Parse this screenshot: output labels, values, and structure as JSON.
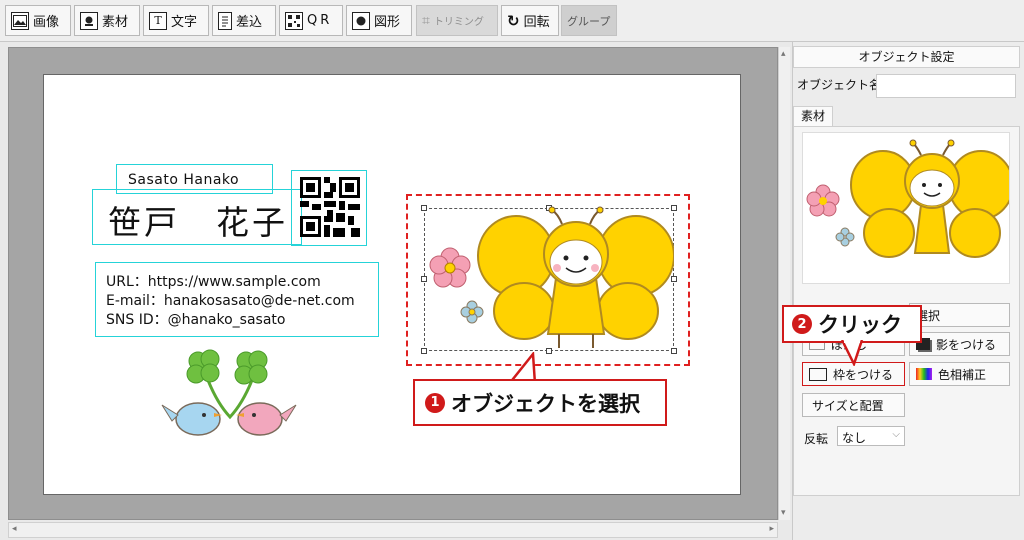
{
  "toolbar": {
    "image": "画像",
    "material": "素材",
    "text": "文字",
    "merge": "差込",
    "qr": "QR",
    "shape": "図形",
    "trimming": "トリミング",
    "rotate": "回転",
    "group": "グループ",
    "text_icon": "T"
  },
  "card": {
    "name_en": "Sasato Hanako",
    "name_jp": "笹戸　花子",
    "info": {
      "url": "URL：https://www.sample.com",
      "email": "E-mail：hanakosasato@de-net.com",
      "sns": "SNS ID：@hanako_sasato"
    }
  },
  "callouts": {
    "step1_num": "1",
    "step1": "オブジェクトを選択",
    "step2_num": "2",
    "step2": "クリック"
  },
  "panel": {
    "title": "オブジェクト設定",
    "object_name_label": "オブジェクト名",
    "object_name_value": "",
    "tab_material": "素材",
    "select_button": "選択",
    "blur_button": "ぼかし",
    "shadow_button": "影をつける",
    "frame_button": "枠をつける",
    "hue_button": "色相補正",
    "size_button": "サイズと配置",
    "flip_label": "反転",
    "flip_value": "なし"
  },
  "colors": {
    "accent_red": "#d01a1a",
    "selection_cyan": "#25d3d8",
    "butterfly_yellow": "#ffd200"
  }
}
